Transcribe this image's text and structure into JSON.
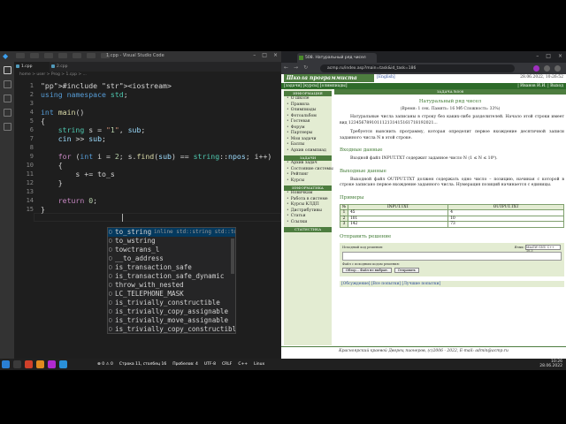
{
  "vscode": {
    "title": "1.cpp - Visual Studio Code",
    "tabs": [
      {
        "label": "1.cpp"
      },
      {
        "label": "2.cpp"
      }
    ],
    "breadcrumb": "home > user > Prog > 1.cpp > ...",
    "code_lines": [
      {
        "n": "1",
        "text": "#include <iostream>"
      },
      {
        "n": "2",
        "text": "using namespace std;"
      },
      {
        "n": "3",
        "text": ""
      },
      {
        "n": "4",
        "text": "int main()"
      },
      {
        "n": "5",
        "text": "{"
      },
      {
        "n": "6",
        "text": "    string s = \"1\", sub;"
      },
      {
        "n": "7",
        "text": "    cin >> sub;"
      },
      {
        "n": "8",
        "text": ""
      },
      {
        "n": "9",
        "text": "    for (int i = 2; s.find(sub) == string::npos; i++)"
      },
      {
        "n": "10",
        "text": "    {"
      },
      {
        "n": "11",
        "text": "        s += to_s"
      },
      {
        "n": "12",
        "text": "    }"
      },
      {
        "n": "13",
        "text": ""
      },
      {
        "n": "14",
        "text": "    return 0;"
      },
      {
        "n": "15",
        "text": "}"
      }
    ],
    "suggestions": [
      {
        "label": "to_string",
        "detail": "inline std::string std::to_string(int __val)"
      },
      {
        "label": "to_wstring"
      },
      {
        "label": "towctrans_l"
      },
      {
        "label": "__to_address"
      },
      {
        "label": "is_transaction_safe"
      },
      {
        "label": "is_transaction_safe_dynamic"
      },
      {
        "label": "throw_with_nested"
      },
      {
        "label": "LC_TELEPHONE_MASK"
      },
      {
        "label": "is_trivially_constructible"
      },
      {
        "label": "is_trivially_copy_assignable"
      },
      {
        "label": "is_trivially_move_assignable"
      },
      {
        "label": "is_trivially_copy_constructible"
      }
    ],
    "status": {
      "problems": "⊗ 0 ⚠ 0",
      "position": "Строка 11, столбец 16",
      "spaces": "Пробелов: 4",
      "encoding": "UTF-8",
      "eol": "CRLF",
      "language": "C++",
      "os": "Linux"
    }
  },
  "browser": {
    "tab_title": "508. Натуральный ряд чисел",
    "url": "acmp.ru/index.asp?main=task&id_task=186",
    "site": {
      "logo": "Школа программиста",
      "lang": "[English]",
      "date": "28.06.2022, 10:26:52",
      "nav": "[задачи] [курсы] [олимпиады]",
      "user": "| Иванов И.И. | Выход",
      "sidebar_sections": [
        {
          "head": "ИНФОРМАЦИЯ",
          "items": [
            "О школе",
            "Правила",
            "Олимпиады",
            "Фотоальбом",
            "Гостевая",
            "Форум",
            "Партнеры",
            "Мои задачи",
            "Баллы",
            "Архив олимпиад"
          ]
        },
        {
          "head": "ЗАДАЧИ",
          "items": [
            "Архив задач",
            "Состояние системы",
            "Рейтинг",
            "Курсы"
          ]
        },
        {
          "head": "ИНФОРМАТИКА",
          "items": [
            "Новичкам",
            "Работа в системе",
            "Курсы КЛДП",
            "Дистрибутивы",
            "Статьи",
            "Ссылки"
          ]
        },
        {
          "head": "СТАТИСТИКА",
          "items": []
        }
      ],
      "content_head": "ЗАДАЧА №508",
      "task_title": "Натуральный ряд чисел",
      "limits": "(Время: 1 сек. Память: 16 Мб Сложность: 33%)",
      "p1": "Натуральные числа записаны в строку без каких-либо разделителей. Начало этой строки имеет вид 123456789101112131415161718192021...",
      "p2": "Требуется выяснить программу, которая определит первое вхождение десятичной записи заданного числа N в этой строке.",
      "input_head": "Входные данные",
      "input_text": "Входной файл INPUT.TXT содержит заданное число N (1 ≤ N ≤ 10⁹).",
      "output_head": "Выходные данные",
      "output_text": "Выходной файл OUTPUT.TXT должен содержать одно число – позицию, начиная с которой в строке записано первое вхождение заданного числа. Нумерация позиций начинается с единицы.",
      "examples_head": "Примеры",
      "table_headers": [
        "№",
        "INPUT.TXT",
        "OUTPUT.TXT"
      ],
      "examples": [
        {
          "n": "1",
          "input": "45",
          "output": "4"
        },
        {
          "n": "2",
          "input": "101",
          "output": "10"
        },
        {
          "n": "3",
          "input": "142",
          "output": "73"
        }
      ],
      "submit_head": "Отправить решение",
      "submit_src_label": "Исходный код решения:",
      "submit_lang_label": "Язык:",
      "submit_lang_value": "MinGW GNU C++ 10.3",
      "submit_file_label": "Файл с исходным кодом решения:",
      "btn_browse": "Обзор... Файл не выбран.",
      "btn_send": "Отправить",
      "links": "[Обсуждение] [Все попытки] [Лучшие попытки]",
      "footer": "Красноярский краевой Дворец пионеров, (c)2006 - 2022, E-mail: admin@acmp.ru"
    }
  },
  "taskbar": {
    "time": "10:26",
    "date": "28.06.2022"
  }
}
